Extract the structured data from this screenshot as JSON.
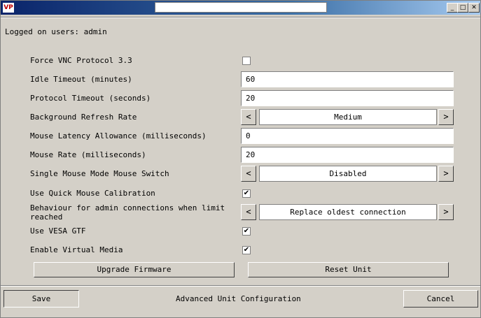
{
  "window": {
    "app_icon": "VP",
    "title": ""
  },
  "logged_on": "Logged on users: admin",
  "rows": [
    {
      "label": "Force VNC Protocol 3.3",
      "checked": false
    },
    {
      "label": "Idle Timeout (minutes)",
      "value": "60"
    },
    {
      "label": "Protocol Timeout (seconds)",
      "value": "20"
    },
    {
      "label": "Background Refresh Rate",
      "selected": "Medium"
    },
    {
      "label": "Mouse Latency Allowance (milliseconds)",
      "value": "0"
    },
    {
      "label": "Mouse Rate (milliseconds)",
      "value": "20"
    },
    {
      "label": "Single Mouse Mode Mouse Switch",
      "selected": "Disabled"
    },
    {
      "label": "Use Quick Mouse Calibration",
      "checked": true
    },
    {
      "label": "Behaviour for admin connections when limit reached",
      "selected": "Replace oldest connection"
    },
    {
      "label": "Use VESA GTF",
      "checked": true
    },
    {
      "label": "Enable Virtual Media",
      "checked": true
    }
  ],
  "buttons": {
    "upgrade": "Upgrade Firmware",
    "reset": "Reset Unit",
    "save": "Save",
    "cancel": "Cancel"
  },
  "status": "Advanced Unit Configuration",
  "arrows": {
    "prev": "<",
    "next": ">"
  },
  "check_mark": "✔",
  "wbtns": {
    "min": "_",
    "max": "□",
    "close": "✕"
  }
}
